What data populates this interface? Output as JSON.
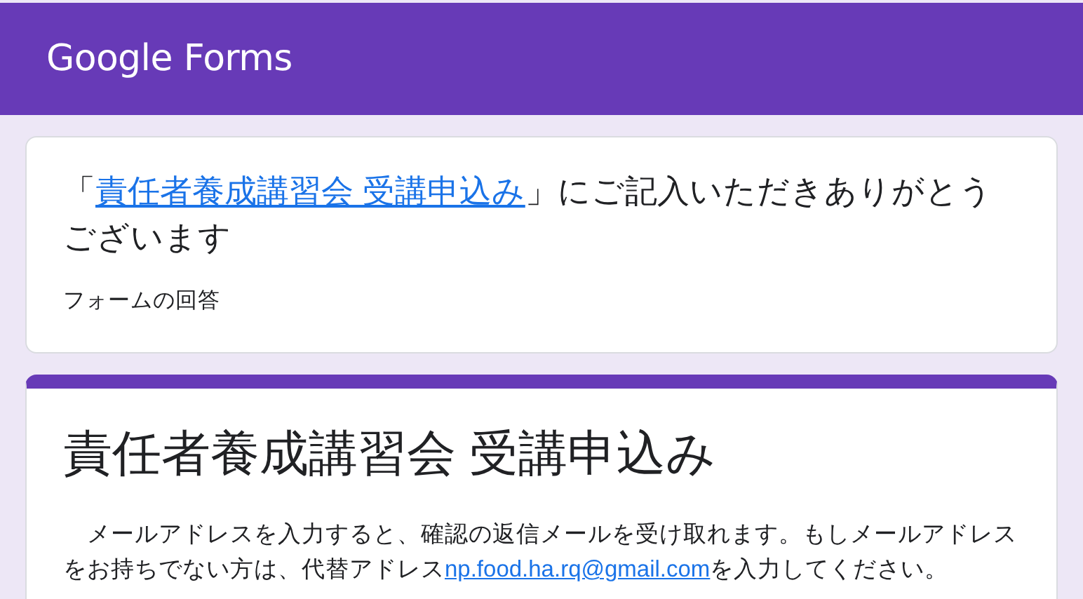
{
  "header": {
    "logo": "Google Forms"
  },
  "confirmation": {
    "before": "「",
    "link": "責任者養成講習会 受講申込み",
    "after": "」にご記入いただきありがとうございます",
    "subtitle": "フォームの回答"
  },
  "form": {
    "title": "責任者養成講習会 受講申込み",
    "description_before": "　メールアドレスを入力すると、確認の返信メールを受け取れます。もしメールアドレスをお持ちでない方は、代替アドレス",
    "description_link": "np.food.ha.rq@gmail.com",
    "description_after": "を入力してください。"
  }
}
